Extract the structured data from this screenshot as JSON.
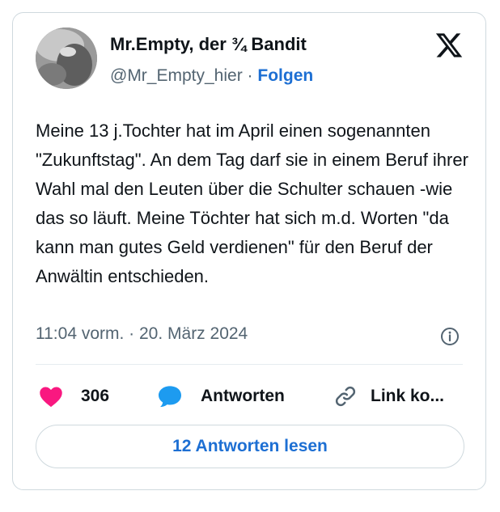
{
  "author": {
    "name": "Mr.Empty, der ¾ Bandit",
    "handle": "@Mr_Empty_hier",
    "separator": "·",
    "follow_label": "Folgen"
  },
  "brand_icon": "x-logo-icon",
  "tweet": {
    "text": "Meine 13 j.Tochter hat im April einen sogenannten \"Zukunftstag\". An dem Tag darf sie in einem Beruf ihrer Wahl mal den Leuten über die Schulter schauen -wie das so läuft. Meine Töchter hat sich m.d. Worten \"da kann man gutes Geld verdienen\" für den Beruf der Anwältin entschieden.",
    "timestamp": "11:04 vorm. · 20. März 2024"
  },
  "actions": {
    "likes": "306",
    "reply_label": "Antworten",
    "link_label": "Link ko..."
  },
  "read_replies_label": "12 Antworten lesen",
  "colors": {
    "heart": "#f91880",
    "reply_bubble": "#1d9bf0",
    "link_blue": "#1d6fd3",
    "secondary_text": "#536471",
    "border": "#cfd9de"
  }
}
